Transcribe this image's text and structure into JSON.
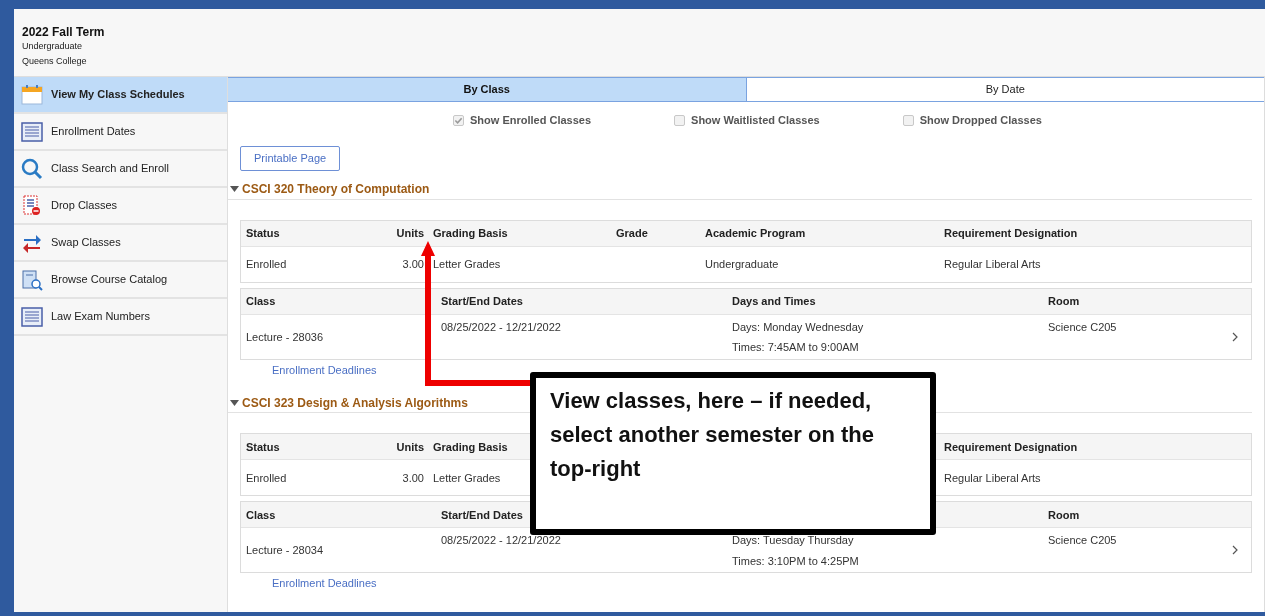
{
  "header": {
    "term": "2022 Fall Term",
    "career": "Undergraduate",
    "institution": "Queens College"
  },
  "sidebar": {
    "items": [
      {
        "label": "View My Class Schedules",
        "selected": true,
        "kind": "calendar"
      },
      {
        "label": "Enrollment Dates",
        "selected": false,
        "kind": "list"
      },
      {
        "label": "Class Search and Enroll",
        "selected": false,
        "kind": "search"
      },
      {
        "label": "Drop Classes",
        "selected": false,
        "kind": "drop"
      },
      {
        "label": "Swap Classes",
        "selected": false,
        "kind": "swap"
      },
      {
        "label": "Browse Course Catalog",
        "selected": false,
        "kind": "catalog"
      },
      {
        "label": "Law Exam Numbers",
        "selected": false,
        "kind": "list"
      }
    ]
  },
  "tabs": [
    {
      "label": "By Class",
      "selected": true
    },
    {
      "label": "By Date",
      "selected": false
    }
  ],
  "filters": [
    {
      "label": "Show Enrolled Classes",
      "checked": true
    },
    {
      "label": "Show Waitlisted Classes",
      "checked": false
    },
    {
      "label": "Show Dropped Classes",
      "checked": false
    }
  ],
  "printable_button": "Printable Page",
  "courses": [
    {
      "title": "CSCI 320 Theory of Computation",
      "expanded": true,
      "enrollment": [
        {
          "kind": "status",
          "header": "Status",
          "value": "Enrolled"
        },
        {
          "kind": "units",
          "header": "Units",
          "value": "3.00"
        },
        {
          "kind": "grading",
          "header": "Grading Basis",
          "value": "Letter Grades"
        },
        {
          "kind": "grade",
          "header": "Grade"
        },
        {
          "kind": "program",
          "header": "Academic Program",
          "value": "Undergraduate"
        },
        {
          "kind": "requirement",
          "header": "Requirement Designation",
          "value": "Regular Liberal Arts"
        }
      ],
      "meeting": [
        {
          "kind": "class",
          "header": "Class",
          "value": "Lecture - 28036"
        },
        {
          "kind": "dates",
          "header": "Start/End Dates",
          "value": "08/25/2022 - 12/21/2022"
        },
        {
          "kind": "days",
          "header": "Days and Times",
          "lines": [
            "Days: Monday Wednesday",
            "Times: 7:45AM to 9:00AM"
          ]
        },
        {
          "kind": "room",
          "header": "Room",
          "value": "Science C205"
        }
      ],
      "link": "Enrollment Deadlines"
    },
    {
      "title": "CSCI 323 Design & Analysis Algorithms",
      "expanded": true,
      "enrollment": [
        {
          "kind": "status",
          "header": "Status",
          "value": "Enrolled"
        },
        {
          "kind": "units",
          "header": "Units",
          "value": "3.00"
        },
        {
          "kind": "grading",
          "header": "Grading Basis",
          "value": "Letter Grades"
        },
        {
          "kind": "requirement",
          "header": "Requirement Designation",
          "value": "Regular Liberal Arts"
        }
      ],
      "meeting": [
        {
          "kind": "class",
          "header": "Class",
          "value": "Lecture - 28034"
        },
        {
          "kind": "dates",
          "header": "Start/End Dates",
          "value": "08/25/2022 - 12/21/2022"
        },
        {
          "kind": "days",
          "lines": [
            "Days: Tuesday Thursday",
            "Times: 3:10PM to 4:25PM"
          ]
        },
        {
          "kind": "room",
          "header": "Room",
          "value": "Science C205"
        }
      ],
      "link": "Enrollment Deadlines"
    }
  ],
  "callout": {
    "text": "View classes, here – if needed, select another semester on the top-right"
  }
}
